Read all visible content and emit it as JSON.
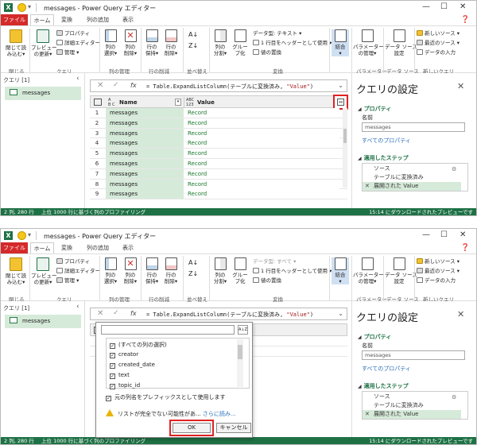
{
  "title": "messages - Power Query エディター",
  "tabs": [
    "ファイル",
    "ホーム",
    "変換",
    "列の追加",
    "表示"
  ],
  "ribbon": {
    "close_apply": "閉じて読\nみ込む▾",
    "preview_refresh": "プレビュー\nの更新▾",
    "properties": "プロパティ",
    "advanced_editor": "詳細エディター",
    "manage": "管理 ▾",
    "choose_columns": "列の\n選択▾",
    "remove_columns": "列の\n削除▾",
    "keep_rows": "行の\n保持▾",
    "remove_rows": "行の\n削除▾",
    "sort_label": "並べ替え",
    "split_column": "列の\n分割▾",
    "group_by": "グルー\nプ化",
    "data_type_1": "データ型: テキスト ▾",
    "data_type_2": "データ型: すべて ▾",
    "first_row_header": "1 行目をヘッダーとして使用 ▾",
    "replace_values": "値の置換",
    "combine": "結合\n▾",
    "manage_params": "パラメーター\nの管理▾",
    "data_source_settings": "データ ソース\n設定",
    "new_source": "新しいソース ▾",
    "recent_sources": "最近のソース ▾",
    "enter_data": "データの入力",
    "groups": {
      "close": "閉じる",
      "query": "クエリ",
      "manage_columns": "列の管理",
      "reduce_rows": "行の削減",
      "sort": "並べ替え",
      "transform": "変換",
      "parameters": "パラメーター",
      "data_source": "データ ソース",
      "new_query": "新しいクエリ"
    }
  },
  "queries": {
    "header": "クエリ [1]",
    "item": "messages"
  },
  "formula": {
    "fx": "fx",
    "prefix": "= Table.ExpandListColumn(テーブルに変換済み, ",
    "string": "\"Value\"",
    "suffix": ")"
  },
  "grid": {
    "col1_type": "A\nB C",
    "col1_name": "Name",
    "col2_type": "ABC\n123",
    "col2_name": "Value",
    "rows": [
      {
        "n": "1",
        "name": "messages",
        "value": "Record"
      },
      {
        "n": "2",
        "name": "messages",
        "value": "Record"
      },
      {
        "n": "3",
        "name": "messages",
        "value": "Record"
      },
      {
        "n": "4",
        "name": "messages",
        "value": "Record"
      },
      {
        "n": "5",
        "name": "messages",
        "value": "Record"
      },
      {
        "n": "6",
        "name": "messages",
        "value": "Record"
      },
      {
        "n": "7",
        "name": "messages",
        "value": "Record"
      },
      {
        "n": "8",
        "name": "messages",
        "value": "Record"
      },
      {
        "n": "9",
        "name": "messages",
        "value": "Record"
      }
    ],
    "rows_w2": [
      {
        "n": "1",
        "name": "messages"
      },
      {
        "n": "2",
        "name": "messages"
      }
    ]
  },
  "settings": {
    "title": "クエリの設定",
    "properties_header": "プロパティ",
    "name_label": "名前",
    "name_value": "messages",
    "all_properties": "すべてのプロパティ",
    "applied_steps_header": "適用したステップ",
    "steps": [
      "ソース",
      "テーブルに変換済み",
      "展開された Value"
    ]
  },
  "status": {
    "cols_rows": "2 列, 280 行",
    "profiling": "上位 1000 行に基づく列のプロファイリング",
    "preview": "15:14 にダウンロードされたプレビューです"
  },
  "popup": {
    "select_all": "(すべての列の選択)",
    "columns": [
      "creator",
      "created_date",
      "text",
      "topic_id"
    ],
    "prefix_option": "元の列名をプレフィックスとして使用します",
    "warning": "リストが完全でない可能性があ...",
    "more": "さらに読み...",
    "ok": "OK",
    "cancel": "キャンセル"
  },
  "colors": {
    "accent": "#1e7145",
    "file_tab": "#d42a2a",
    "highlight": "#e02222",
    "selection": "#d6ead9"
  }
}
